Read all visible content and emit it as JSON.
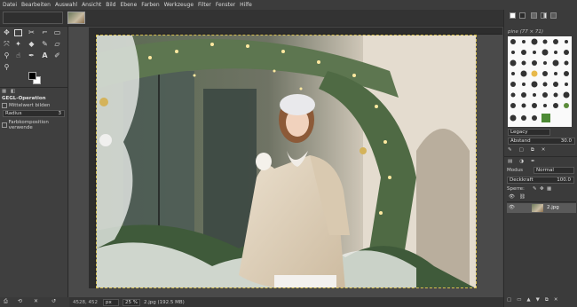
{
  "menubar": [
    "Datei",
    "Bearbeiten",
    "Auswahl",
    "Ansicht",
    "Bild",
    "Ebene",
    "Farben",
    "Werkzeuge",
    "Filter",
    "Fenster",
    "Hilfe"
  ],
  "gegl": {
    "title": "GEGL-Operation",
    "checkbox1": "Mittelwert bilden",
    "dropdown_value": "Radius",
    "dropdown_number": "3",
    "checkbox2": "Farbkomposition verwende"
  },
  "status": {
    "coords": "4528, 452",
    "unit": "px",
    "zoom": "25 %",
    "file": "2.jpg (192.5 MB)"
  },
  "brushes": {
    "header": "pine (77 × 71)",
    "preset": "Legacy",
    "spacing_label": "Abstand",
    "spacing_value": "30.0"
  },
  "layers": {
    "mode_label": "Modus",
    "mode_value": "Normal",
    "opacity_label": "Deckkraft",
    "opacity_value": "100.0",
    "lock_label": "Sperre:",
    "layer_name": "2.jpg"
  },
  "colors": {
    "accent": "#d8c050",
    "panel_bg": "#3b3b3b",
    "selected_row": "#5a5a5a"
  }
}
